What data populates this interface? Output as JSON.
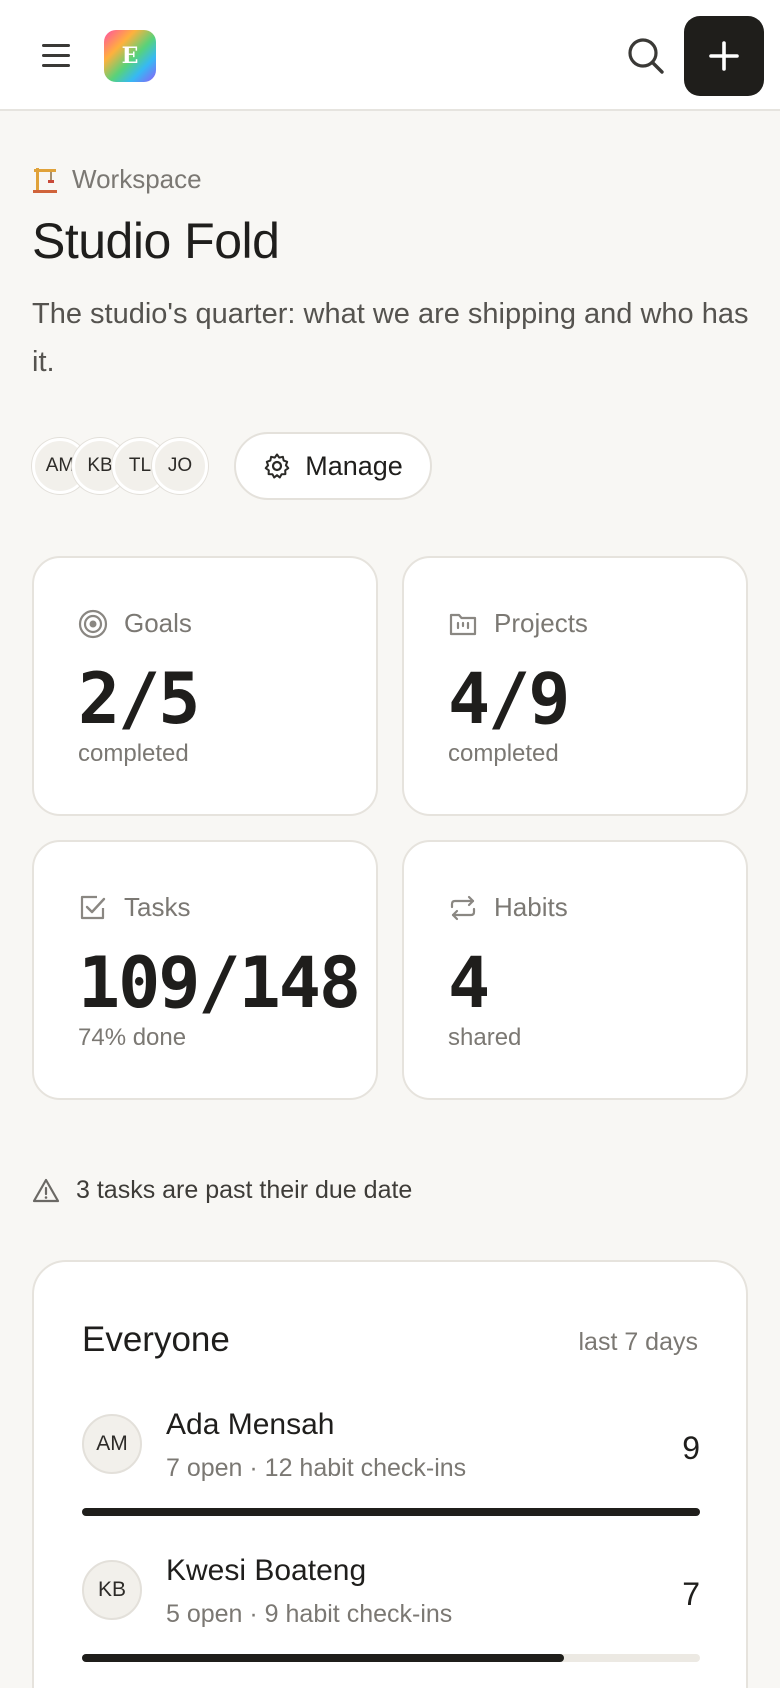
{
  "header": {
    "logo_letter": "E"
  },
  "workspace": {
    "crumb_label": "Workspace",
    "title": "Studio Fold",
    "description": "The studio's quarter: what we are shipping and who has it.",
    "members": [
      "AM",
      "KB",
      "TL",
      "JO"
    ],
    "manage_label": "Manage"
  },
  "stats": [
    {
      "label": "Goals",
      "value": "2/5",
      "sub": "completed"
    },
    {
      "label": "Projects",
      "value": "4/9",
      "sub": "completed"
    },
    {
      "label": "Tasks",
      "value": "109/148",
      "sub": "74% done"
    },
    {
      "label": "Habits",
      "value": "4",
      "sub": "shared"
    }
  ],
  "alert": {
    "text": "3 tasks are past their due date"
  },
  "everyone": {
    "title": "Everyone",
    "range": "last 7 days",
    "people": [
      {
        "initials": "AM",
        "name": "Ada Mensah",
        "meta": "7 open · 12 habit check-ins",
        "count": "9",
        "progress": 1.0
      },
      {
        "initials": "KB",
        "name": "Kwesi Boateng",
        "meta": "5 open · 9 habit check-ins",
        "count": "7",
        "progress": 0.78
      }
    ]
  },
  "colors": {
    "background": "#f8f7f4",
    "accent_dark": "#1f1e1b",
    "muted_text": "#7b7873",
    "alert_icon": "#6b6965"
  }
}
